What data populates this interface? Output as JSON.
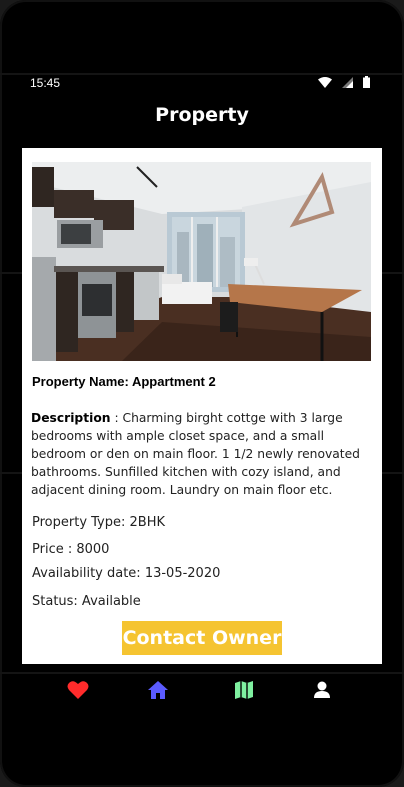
{
  "status_bar": {
    "time": "15:45"
  },
  "header": {
    "title": "Property"
  },
  "property": {
    "name_label": "Property Name: Appartment 2",
    "description_label": "Description",
    "description_text": " : Charming birght cottge with 3 large bedrooms with ample closet space, and a small bedroom or den on main floor. 1 1/2 newly renovated bathrooms. Sunfilled kitchen with cozy island, and adjacent dining room. Laundry on main floor etc.",
    "type_line": "Property Type: 2BHK",
    "price_line": "Price : 8000",
    "availability_line": "Availability date: 13-05-2020",
    "status_line": "Status: Available"
  },
  "actions": {
    "contact_label": "Contact Owner"
  },
  "bottom_nav": {
    "items": [
      {
        "icon": "heart-icon",
        "color": "#ff2b2b"
      },
      {
        "icon": "home-icon",
        "color": "#5b5bff"
      },
      {
        "icon": "map-icon",
        "color": "#7ff0a0"
      },
      {
        "icon": "person-icon",
        "color": "#ffffff"
      }
    ]
  },
  "colors": {
    "background": "#000000",
    "card": "#ffffff",
    "contact_button": "#f5c431"
  }
}
